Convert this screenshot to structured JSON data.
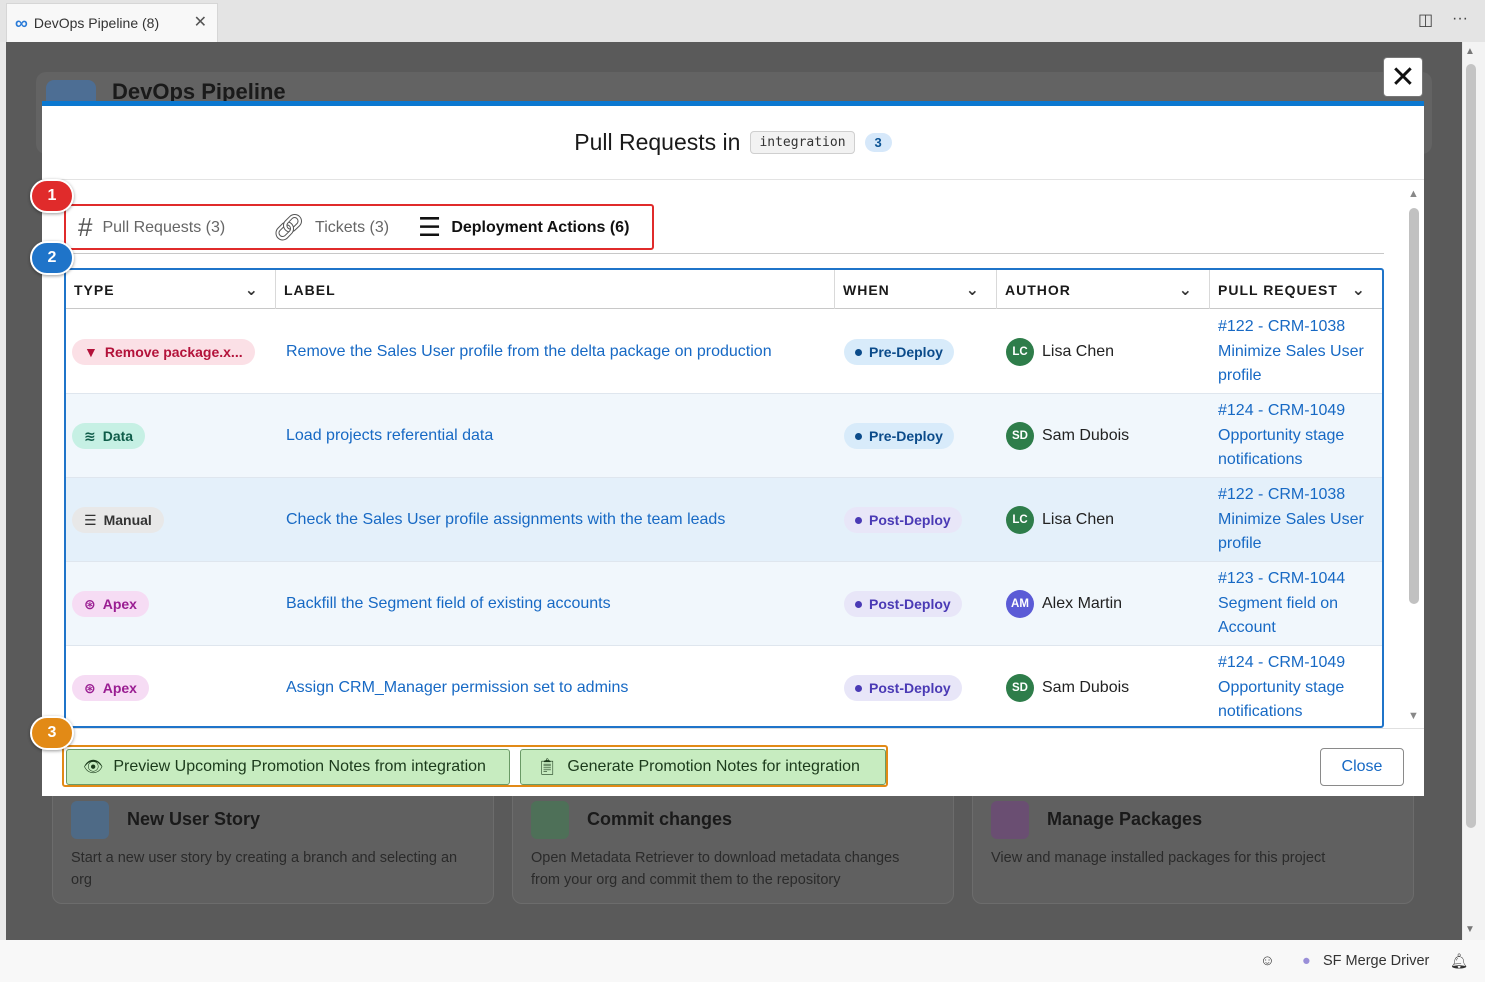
{
  "editor": {
    "tab_title": "DevOps Pipeline (8)",
    "tab_icon": "infinity-icon"
  },
  "background": {
    "app_title": "DevOps Pipeline",
    "cards": [
      {
        "title": "New User Story",
        "desc": "Start a new user story by creating a branch and selecting an org",
        "icon": "plus-icon"
      },
      {
        "title": "Commit changes",
        "desc": "Open Metadata Retriever to download metadata changes from your org and commit them to the repository",
        "icon": "download-icon"
      },
      {
        "title": "Manage Packages",
        "desc": "View and manage installed packages for this project",
        "icon": "package-icon"
      }
    ]
  },
  "modal": {
    "title": "Pull Requests in",
    "branch": "integration",
    "count": "3",
    "tabs": [
      {
        "label": "Pull Requests (3)",
        "icon": "hash-icon",
        "active": false
      },
      {
        "label": "Tickets (3)",
        "icon": "link-icon",
        "active": false
      },
      {
        "label": "Deployment Actions (6)",
        "icon": "checklist-icon",
        "active": true
      }
    ],
    "columns": [
      "TYPE",
      "LABEL",
      "WHEN",
      "AUTHOR",
      "PULL REQUEST"
    ],
    "rows": [
      {
        "type": "Remove package.x...",
        "type_kind": "remove",
        "label": "Remove the Sales User profile from the delta package on production",
        "when": "Pre-Deploy",
        "author_initials": "LC",
        "author": "Lisa Chen",
        "pr": "#122 - CRM-1038 Minimize Sales User profile"
      },
      {
        "type": "Data",
        "type_kind": "data",
        "label": "Load projects referential data",
        "when": "Pre-Deploy",
        "author_initials": "SD",
        "author": "Sam Dubois",
        "pr": "#124 - CRM-1049 Opportunity stage notifications"
      },
      {
        "type": "Manual",
        "type_kind": "manual",
        "label": "Check the Sales User profile assignments with the team leads",
        "when": "Post-Deploy",
        "author_initials": "LC",
        "author": "Lisa Chen",
        "pr": "#122 - CRM-1038 Minimize Sales User profile"
      },
      {
        "type": "Apex",
        "type_kind": "apex",
        "label": "Backfill the Segment field of existing accounts",
        "when": "Post-Deploy",
        "author_initials": "AM",
        "author": "Alex Martin",
        "pr": "#123 - CRM-1044 Segment field on Account"
      },
      {
        "type": "Apex",
        "type_kind": "apex",
        "label": "Assign CRM_Manager permission set to admins",
        "when": "Post-Deploy",
        "author_initials": "SD",
        "author": "Sam Dubois",
        "pr": "#124 - CRM-1049 Opportunity stage notifications"
      }
    ],
    "actions": {
      "preview": "Preview Upcoming Promotion Notes from integration",
      "generate": "Generate Promotion Notes for integration",
      "close": "Close"
    },
    "markers": [
      "1",
      "2",
      "3"
    ]
  },
  "statusbar": {
    "merge_driver": "SF Merge Driver"
  },
  "colors": {
    "accent": "#0b78d0",
    "marker1": "#e02b2b",
    "marker2": "#1f74c9",
    "marker3": "#e28a16",
    "avatar_lc": "#2e7d4a",
    "avatar_sd": "#2e7d4a",
    "avatar_am": "#5b5bd6"
  }
}
